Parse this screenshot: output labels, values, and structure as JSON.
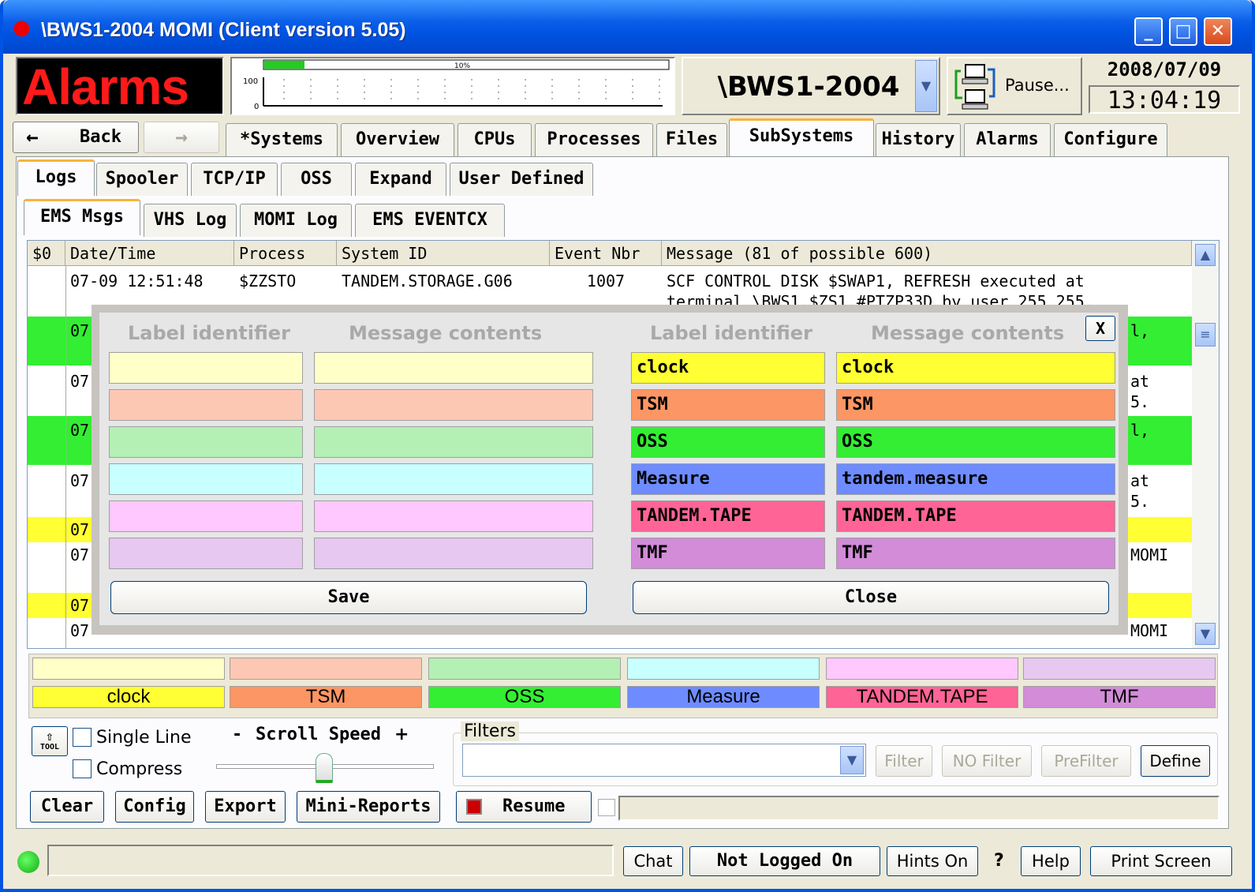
{
  "window": {
    "title": "\\BWS1-2004 MOMI (Client version 5.05)"
  },
  "header": {
    "logo": "Alarms",
    "graph": {
      "percent_label": "10%",
      "y_top": "100",
      "y_bottom": "0",
      "progress": 0.1
    },
    "system": "\\BWS1-2004",
    "pause_label": "Pause...",
    "date": "2008/07/09",
    "time": "13:04:19"
  },
  "nav": {
    "back": "Back",
    "tabs": [
      "*Systems",
      "Overview",
      "CPUs",
      "Processes",
      "Files",
      "SubSystems",
      "History",
      "Alarms",
      "Configure"
    ],
    "active": "SubSystems"
  },
  "subtabs": {
    "items": [
      "Logs",
      "Spooler",
      "TCP/IP",
      "OSS",
      "Expand",
      "User Defined"
    ],
    "active": "Logs"
  },
  "logtabs": {
    "items": [
      "EMS Msgs",
      "VHS Log",
      "MOMI Log",
      "EMS EVENTCX"
    ],
    "active": "EMS Msgs"
  },
  "table": {
    "headers": [
      "$0",
      "Date/Time",
      "Process",
      "System ID",
      "Event Nbr",
      "Message   (81 of possible 600)"
    ],
    "row1": {
      "date": "07-09 12:51:48",
      "process": "$ZZSTO",
      "system": "TANDEM.STORAGE.G06",
      "event": "1007",
      "msg1": "SCF CONTROL DISK $SWAP1, REFRESH executed at",
      "msg2": "terminal \\BWS1.$ZS1.#PTZP33D by user 255,255."
    },
    "partial_dates": [
      "07",
      "07",
      "07",
      "07",
      "07",
      "07",
      "07",
      "07"
    ],
    "right_frags": [
      "l,",
      "at",
      "5.",
      "l,",
      "at",
      "5.",
      "MOMI",
      "MOMI"
    ]
  },
  "modal": {
    "col_headers": [
      "Label identifier",
      "Message contents",
      "Label identifier",
      "Message contents"
    ],
    "close_x": "X",
    "rows": [
      {
        "label": "clock",
        "message": "clock"
      },
      {
        "label": "TSM",
        "message": "TSM"
      },
      {
        "label": "OSS",
        "message": "OSS"
      },
      {
        "label": "Measure",
        "message": "tandem.measure"
      },
      {
        "label": "TANDEM.TAPE",
        "message": "TANDEM.TAPE"
      },
      {
        "label": "TMF",
        "message": "TMF"
      }
    ],
    "save": "Save",
    "close": "Close"
  },
  "colors": {
    "light": [
      "#ffffc8",
      "#fcc8b4",
      "#b4f0b4",
      "#c8ffff",
      "#ffc8ff",
      "#e6c8f0"
    ],
    "strong": [
      "#ffff33",
      "#fc9664",
      "#33ee33",
      "#6e8cff",
      "#ff6496",
      "#d28cd8"
    ]
  },
  "legend": [
    "clock",
    "TSM",
    "OSS",
    "Measure",
    "TANDEM.TAPE",
    "TMF"
  ],
  "controls": {
    "tool": "TOOL",
    "single_line": "Single Line",
    "compress": "Compress",
    "scroll_speed": "Scroll Speed",
    "minus": "-",
    "plus": "+",
    "filters_label": "Filters",
    "filter": "Filter",
    "no_filter": "NO Filter",
    "prefilter": "PreFilter",
    "define": "Define",
    "clear": "Clear",
    "config": "Config",
    "export": "Export",
    "mini_reports": "Mini-Reports",
    "resume": "Resume"
  },
  "statusbar": {
    "chat": "Chat",
    "login": "Not Logged On",
    "hints": "Hints On",
    "question": "?",
    "help": "Help",
    "print": "Print Screen"
  },
  "icons": [
    "alarm-bulb-icon",
    "minimize-icon",
    "maximize-icon",
    "close-icon",
    "back-arrow-icon",
    "forward-arrow-icon",
    "computers-icon",
    "chevron-down-icon",
    "chevron-up-icon",
    "tool-icon",
    "status-led-icon",
    "stop-icon"
  ]
}
